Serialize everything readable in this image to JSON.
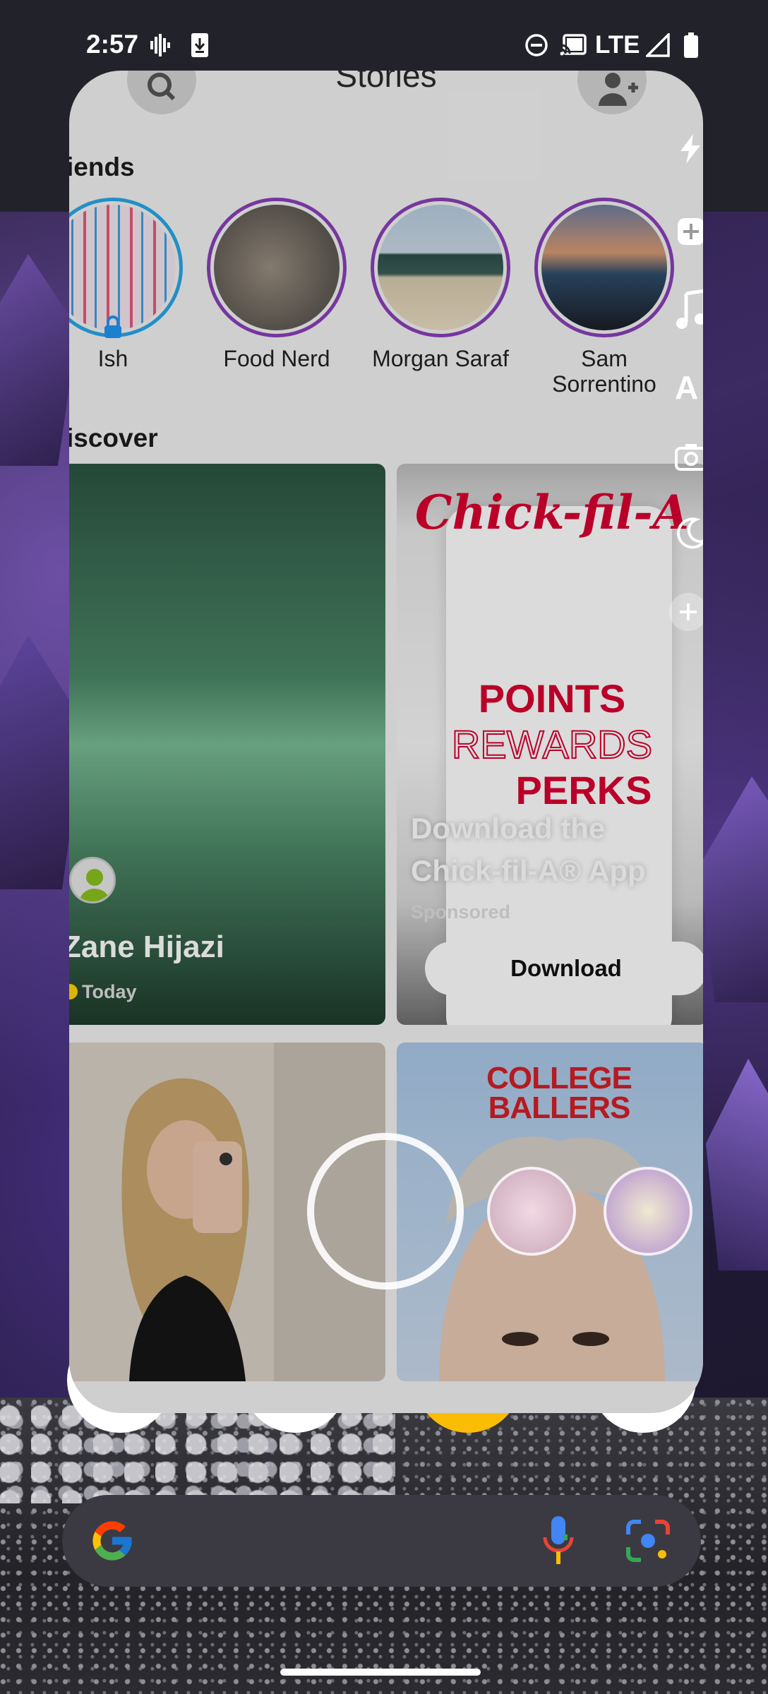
{
  "status_bar": {
    "time": "2:57",
    "network": "LTE",
    "icons": [
      "voicemail-icon",
      "download-icon",
      "do-not-disturb-icon",
      "cast-icon",
      "lte-signal-icon",
      "battery-icon"
    ]
  },
  "snapchat": {
    "header": {
      "title": "Stories",
      "left_icon": "search-icon",
      "right_icon": "add-friend-icon"
    },
    "friends_section": {
      "title": "iends"
    },
    "stories": [
      {
        "name": "Ish",
        "ring": "blue",
        "locked": true
      },
      {
        "name": "Food Nerd",
        "ring": "purple"
      },
      {
        "name": "Morgan Saraf",
        "ring": "purple"
      },
      {
        "name": "Sam Sorrentino",
        "ring": "purple"
      }
    ],
    "discover_section": {
      "title": "iscover"
    },
    "discover_tiles": {
      "zane": {
        "name": "Zane Hijazi",
        "date": "Today"
      },
      "ad": {
        "logo": "Chick-fil-A",
        "promo": [
          "POINTS",
          "REWARDS",
          "PERKS"
        ],
        "headline": "Download the Chick-fil-A® App",
        "sponsored": "Sponsored",
        "button": "Download"
      },
      "college": {
        "title": "COLLEGE BALLERS"
      }
    },
    "camera_tools": [
      "flash-icon",
      "add-icon",
      "music-icon",
      "text-icon",
      "camera-flip-icon",
      "night-mode-icon",
      "more-icon"
    ]
  },
  "home": {
    "search_bar": {
      "logo": "G",
      "icons": [
        "microphone-icon",
        "google-lens-icon"
      ]
    }
  },
  "colors": {
    "story_ring": "#8a3fb8",
    "story_ring_blue": "#28a7e8",
    "chick_fil_a_red": "#d9002f"
  }
}
